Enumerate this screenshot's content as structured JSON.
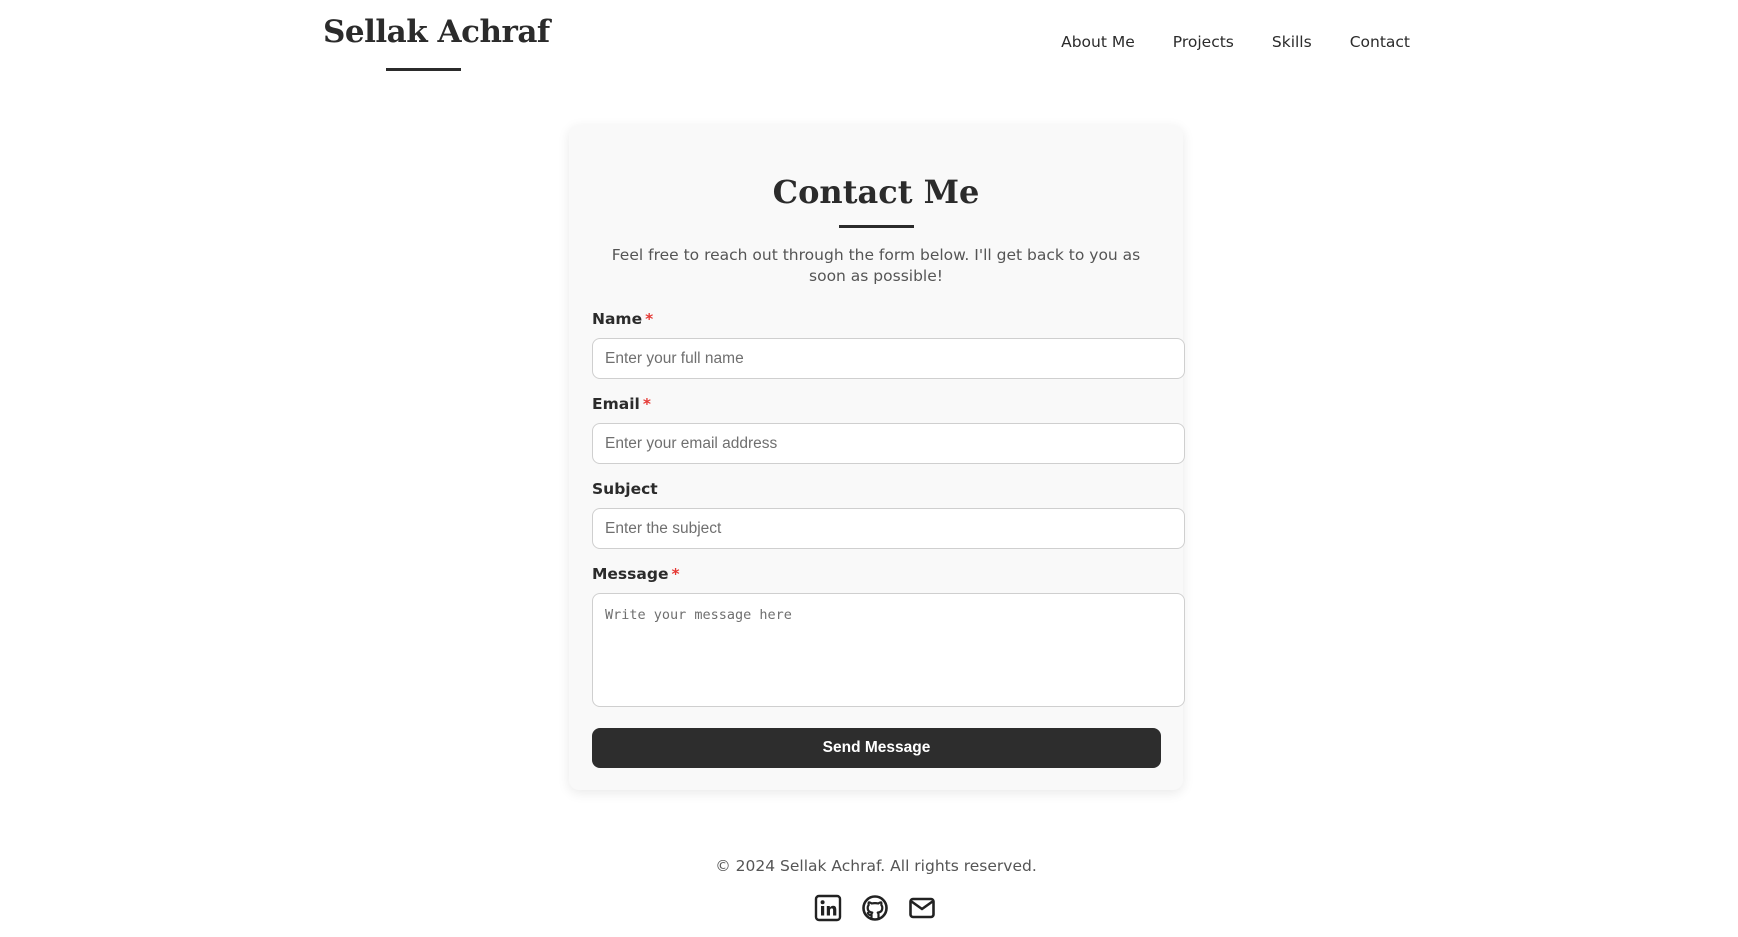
{
  "header": {
    "logo": "Sellak Achraf",
    "nav": [
      "About Me",
      "Projects",
      "Skills",
      "Contact"
    ]
  },
  "contact": {
    "title": "Contact Me",
    "description": "Feel free to reach out through the form below. I'll get back to you as soon as possible!",
    "fields": {
      "name": {
        "label": "Name",
        "required_mark": "*",
        "placeholder": "Enter your full name",
        "value": ""
      },
      "email": {
        "label": "Email",
        "required_mark": "*",
        "placeholder": "Enter your email address",
        "value": ""
      },
      "subject": {
        "label": "Subject",
        "placeholder": "Enter the subject",
        "value": ""
      },
      "message": {
        "label": "Message",
        "required_mark": "*",
        "placeholder": "Write your message here",
        "value": ""
      }
    },
    "submit_label": "Send Message"
  },
  "footer": {
    "copyright": "© 2024 Sellak Achraf. All rights reserved.",
    "social_icons": [
      "linkedin-icon",
      "github-icon",
      "mail-icon"
    ]
  },
  "colors": {
    "text_dark": "#2b2b2b",
    "text_muted": "#555555",
    "required": "#e53935",
    "button_bg": "#2d2d2d",
    "card_bg": "#f9f9f9"
  }
}
